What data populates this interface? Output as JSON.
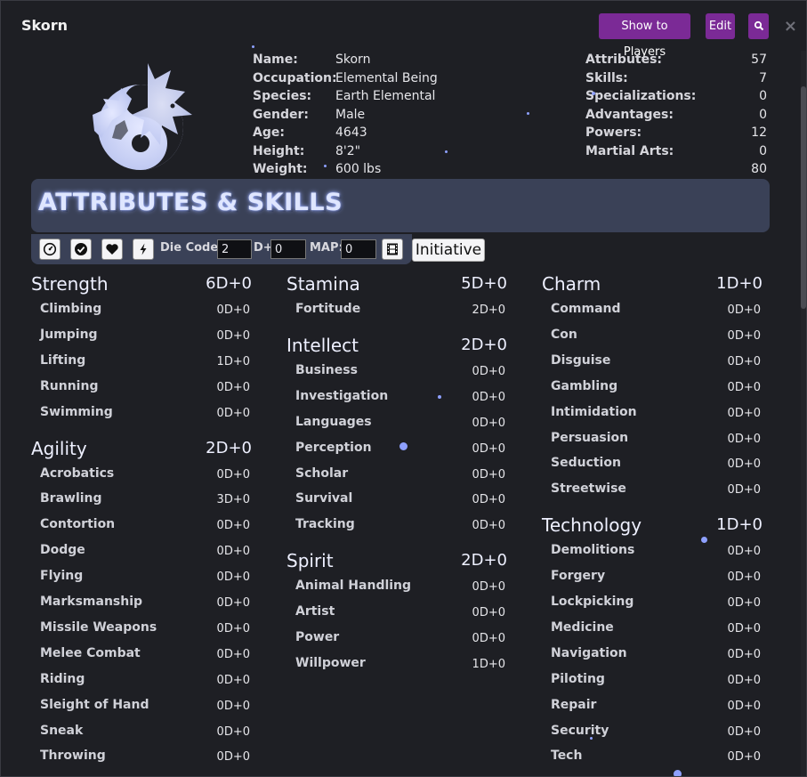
{
  "window": {
    "title": "Skorn",
    "buttons": {
      "show_players": "Show to Players",
      "edit": "Edit"
    }
  },
  "profile": [
    {
      "label": "Name:",
      "value": "Skorn"
    },
    {
      "label": "Occupation:",
      "value": "Elemental Being"
    },
    {
      "label": "Species:",
      "value": "Earth Elemental"
    },
    {
      "label": "Gender:",
      "value": "Male"
    },
    {
      "label": "Age:",
      "value": "4643"
    },
    {
      "label": "Height:",
      "value": "8'2\""
    },
    {
      "label": "Weight:",
      "value": "600 lbs"
    }
  ],
  "totals": [
    {
      "label": "Attributes:",
      "value": "57"
    },
    {
      "label": "Skills:",
      "value": "7"
    },
    {
      "label": "Specializations:",
      "value": "0"
    },
    {
      "label": "Advantages:",
      "value": "0"
    },
    {
      "label": "Powers:",
      "value": "12"
    },
    {
      "label": "Martial Arts:",
      "value": "0"
    },
    {
      "label": "",
      "value": "80"
    }
  ],
  "section": {
    "title": "ATTRIBUTES & SKILLS"
  },
  "toolbar": {
    "die_code_label": "Die Code:",
    "die_code_value": "2",
    "d_plus_label": "D+",
    "d_plus_value": "0",
    "map_label": "MAP:",
    "map_value": "0",
    "initiative": "Initiative"
  },
  "columns": [
    [
      {
        "name": "Strength",
        "value": "6D+0",
        "skills": [
          {
            "name": "Climbing",
            "value": "0D+0"
          },
          {
            "name": "Jumping",
            "value": "0D+0"
          },
          {
            "name": "Lifting",
            "value": "1D+0"
          },
          {
            "name": "Running",
            "value": "0D+0"
          },
          {
            "name": "Swimming",
            "value": "0D+0"
          }
        ]
      },
      {
        "name": "Agility",
        "value": "2D+0",
        "skills": [
          {
            "name": "Acrobatics",
            "value": "0D+0"
          },
          {
            "name": "Brawling",
            "value": "3D+0"
          },
          {
            "name": "Contortion",
            "value": "0D+0"
          },
          {
            "name": "Dodge",
            "value": "0D+0"
          },
          {
            "name": "Flying",
            "value": "0D+0"
          },
          {
            "name": "Marksmanship",
            "value": "0D+0"
          },
          {
            "name": "Missile Weapons",
            "value": "0D+0"
          },
          {
            "name": "Melee Combat",
            "value": "0D+0"
          },
          {
            "name": "Riding",
            "value": "0D+0"
          },
          {
            "name": "Sleight of Hand",
            "value": "0D+0"
          },
          {
            "name": "Sneak",
            "value": "0D+0"
          },
          {
            "name": "Throwing",
            "value": "0D+0"
          }
        ]
      }
    ],
    [
      {
        "name": "Stamina",
        "value": "5D+0",
        "skills": [
          {
            "name": "Fortitude",
            "value": "2D+0"
          }
        ]
      },
      {
        "name": "Intellect",
        "value": "2D+0",
        "skills": [
          {
            "name": "Business",
            "value": "0D+0"
          },
          {
            "name": "Investigation",
            "value": "0D+0"
          },
          {
            "name": "Languages",
            "value": "0D+0"
          },
          {
            "name": "Perception",
            "value": "0D+0"
          },
          {
            "name": "Scholar",
            "value": "0D+0"
          },
          {
            "name": "Survival",
            "value": "0D+0"
          },
          {
            "name": "Tracking",
            "value": "0D+0"
          }
        ]
      },
      {
        "name": "Spirit",
        "value": "2D+0",
        "skills": [
          {
            "name": "Animal Handling",
            "value": "0D+0"
          },
          {
            "name": "Artist",
            "value": "0D+0"
          },
          {
            "name": "Power",
            "value": "0D+0"
          },
          {
            "name": "Willpower",
            "value": "1D+0"
          }
        ]
      }
    ],
    [
      {
        "name": "Charm",
        "value": "1D+0",
        "skills": [
          {
            "name": "Command",
            "value": "0D+0"
          },
          {
            "name": "Con",
            "value": "0D+0"
          },
          {
            "name": "Disguise",
            "value": "0D+0"
          },
          {
            "name": "Gambling",
            "value": "0D+0"
          },
          {
            "name": "Intimidation",
            "value": "0D+0"
          },
          {
            "name": "Persuasion",
            "value": "0D+0"
          },
          {
            "name": "Seduction",
            "value": "0D+0"
          },
          {
            "name": "Streetwise",
            "value": "0D+0"
          }
        ]
      },
      {
        "name": "Technology",
        "value": "1D+0",
        "skills": [
          {
            "name": "Demolitions",
            "value": "0D+0"
          },
          {
            "name": "Forgery",
            "value": "0D+0"
          },
          {
            "name": "Lockpicking",
            "value": "0D+0"
          },
          {
            "name": "Medicine",
            "value": "0D+0"
          },
          {
            "name": "Navigation",
            "value": "0D+0"
          },
          {
            "name": "Piloting",
            "value": "0D+0"
          },
          {
            "name": "Repair",
            "value": "0D+0"
          },
          {
            "name": "Security",
            "value": "0D+0"
          },
          {
            "name": "Tech",
            "value": "0D+0"
          }
        ]
      }
    ]
  ],
  "colors": {
    "accent": "#7b2a96",
    "banner": "#3a4157",
    "glow": "#9fb2ff"
  }
}
